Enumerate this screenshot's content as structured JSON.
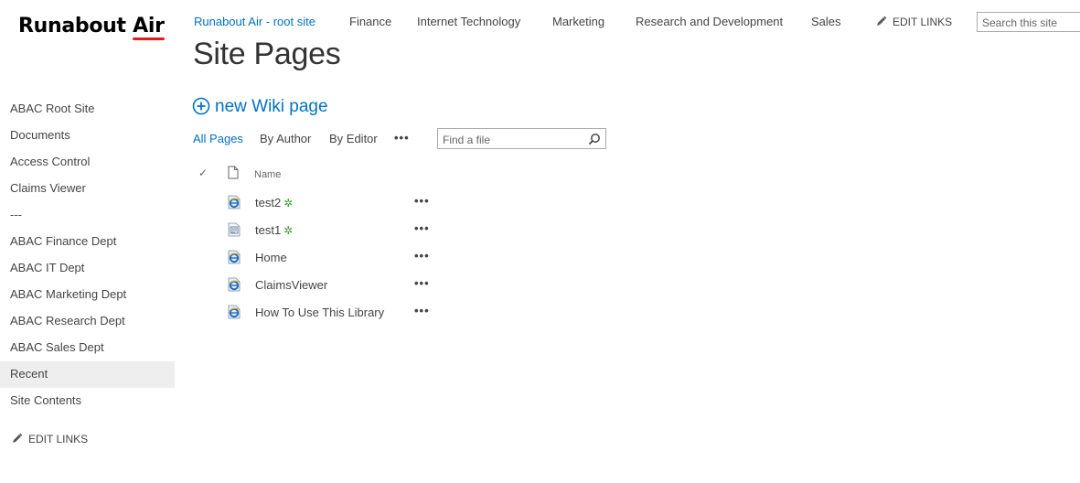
{
  "logo": {
    "text_main": "Runabout",
    "text_accent": "Air"
  },
  "topnav": {
    "items": [
      {
        "label": "Runabout Air - root site",
        "active": true
      },
      {
        "label": "Finance",
        "active": false
      },
      {
        "label": "Internet Technology",
        "active": false
      },
      {
        "label": "Marketing",
        "active": false
      },
      {
        "label": "Research and Development",
        "active": false
      },
      {
        "label": "Sales",
        "active": false
      }
    ],
    "edit_links": "EDIT LINKS"
  },
  "search": {
    "placeholder": "Search this site"
  },
  "page": {
    "title": "Site Pages"
  },
  "leftnav": {
    "items": [
      {
        "label": "ABAC Root Site"
      },
      {
        "label": "Documents"
      },
      {
        "label": "Access Control"
      },
      {
        "label": "Claims Viewer"
      },
      {
        "label": "---"
      },
      {
        "label": "ABAC Finance Dept"
      },
      {
        "label": "ABAC IT Dept"
      },
      {
        "label": "ABAC Marketing Dept"
      },
      {
        "label": "ABAC Research Dept"
      },
      {
        "label": "ABAC Sales Dept"
      },
      {
        "label": "Recent"
      },
      {
        "label": "Site Contents"
      }
    ],
    "selected_index": 10,
    "edit_links": "EDIT LINKS"
  },
  "library": {
    "new_wiki_label": "new Wiki page",
    "views": [
      "All Pages",
      "By Author",
      "By Editor"
    ],
    "more_views": "•••",
    "find_placeholder": "Find a file",
    "column_name": "Name",
    "rows": [
      {
        "name": "test2",
        "icon": "ie-page-icon",
        "is_new": true
      },
      {
        "name": "test1",
        "icon": "web-page-icon",
        "is_new": true
      },
      {
        "name": "Home",
        "icon": "ie-page-icon",
        "is_new": false
      },
      {
        "name": "ClaimsViewer",
        "icon": "ie-page-icon",
        "is_new": false
      },
      {
        "name": "How To Use This Library",
        "icon": "ie-page-icon",
        "is_new": false
      }
    ],
    "row_menu": "•••",
    "new_badge": "✲"
  },
  "colors": {
    "accent": "#0072c6",
    "logo_underline": "#e01b1b",
    "new_badge": "#3a9e2b"
  }
}
